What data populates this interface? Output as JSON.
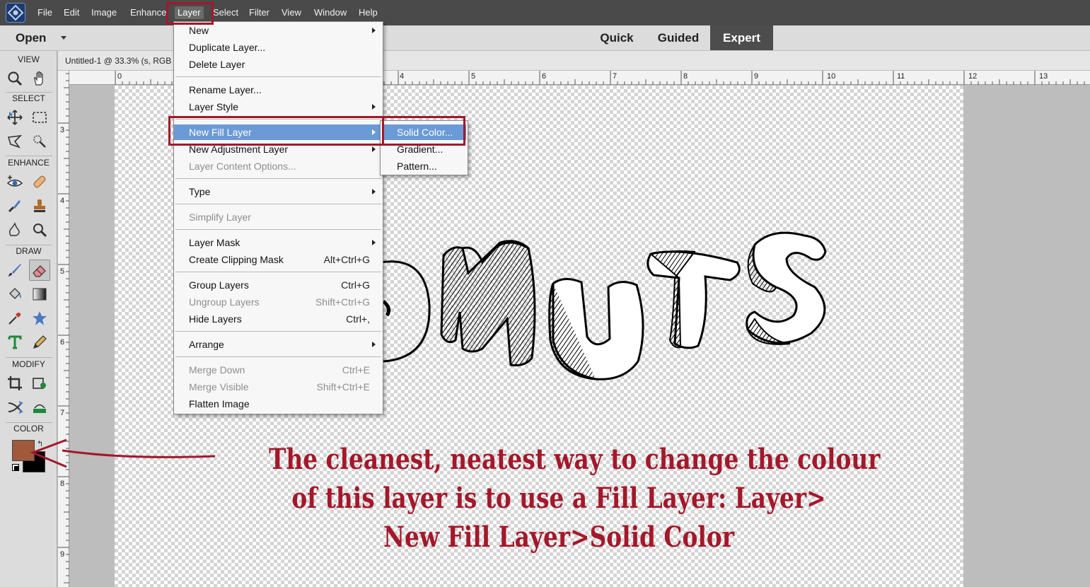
{
  "menubar": {
    "items": [
      "File",
      "Edit",
      "Image",
      "Enhance",
      "Layer",
      "Select",
      "Filter",
      "View",
      "Window",
      "Help"
    ],
    "active": "Layer"
  },
  "modebar": {
    "open_label": "Open",
    "tabs": [
      "Quick",
      "Guided",
      "Expert"
    ],
    "active_tab": "Expert"
  },
  "toolbox": {
    "sections": [
      "VIEW",
      "SELECT",
      "ENHANCE",
      "DRAW",
      "MODIFY",
      "COLOR"
    ],
    "tools": [
      "zoom-tool",
      "hand-tool",
      "move-tool",
      "marquee-tool",
      "lasso-tool",
      "quick-selection-tool",
      "red-eye-tool",
      "spot-healing-tool",
      "smart-brush-tool",
      "clone-stamp-tool",
      "sponge-tool",
      "zoom-enhance-tool",
      "brush-tool",
      "eraser-tool",
      "paint-bucket-tool",
      "gradient-tool",
      "eyedropper-tool",
      "custom-shape-tool",
      "type-tool",
      "pencil-tool",
      "crop-tool",
      "recompose-tool",
      "content-aware-move-tool",
      "straighten-tool"
    ],
    "active_tool": "eraser-tool",
    "foreground_color": "#a05a3b",
    "background_color": "#000000"
  },
  "document": {
    "tab_label": "Untitled-1 @ 33.3% (s, RGB",
    "h_ruler_labels": [
      "0",
      "4",
      "5",
      "6",
      "7",
      "8",
      "9",
      "10",
      "11",
      "12",
      "13"
    ],
    "v_ruler_labels": [
      "3",
      "4",
      "5",
      "6",
      "7",
      "8",
      "9"
    ]
  },
  "layer_menu": {
    "groups": [
      [
        {
          "label": "New",
          "submenu": true
        },
        {
          "label": "Duplicate Layer..."
        },
        {
          "label": "Delete Layer"
        }
      ],
      [
        {
          "label": "Rename Layer..."
        },
        {
          "label": "Layer Style",
          "submenu": true
        }
      ],
      [
        {
          "label": "New Fill Layer",
          "submenu": true,
          "highlighted": true
        },
        {
          "label": "New Adjustment Layer",
          "submenu": true
        },
        {
          "label": "Layer Content Options...",
          "disabled": true
        }
      ],
      [
        {
          "label": "Type",
          "submenu": true
        }
      ],
      [
        {
          "label": "Simplify Layer",
          "disabled": true
        }
      ],
      [
        {
          "label": "Layer Mask",
          "submenu": true
        },
        {
          "label": "Create Clipping Mask",
          "shortcut": "Alt+Ctrl+G"
        }
      ],
      [
        {
          "label": "Group Layers",
          "shortcut": "Ctrl+G"
        },
        {
          "label": "Ungroup Layers",
          "shortcut": "Shift+Ctrl+G",
          "disabled": true
        },
        {
          "label": "Hide Layers",
          "shortcut": "Ctrl+,"
        }
      ],
      [
        {
          "label": "Arrange",
          "submenu": true
        }
      ],
      [
        {
          "label": "Merge Down",
          "shortcut": "Ctrl+E",
          "disabled": true
        },
        {
          "label": "Merge Visible",
          "shortcut": "Shift+Ctrl+E",
          "disabled": true
        },
        {
          "label": "Flatten Image"
        }
      ]
    ]
  },
  "fill_submenu": {
    "items": [
      "Solid Color...",
      "Gradient...",
      "Pattern..."
    ],
    "highlighted": "Solid Color..."
  },
  "caption": {
    "lines": [
      "The cleanest, neatest way to change the colour",
      "of this layer is to use a Fill Layer: Layer>",
      "New Fill Layer>Solid Color"
    ],
    "color": "#a3182a"
  },
  "colors": {
    "annotation_red": "#a3182a",
    "menu_highlight": "#6b9ad6"
  }
}
